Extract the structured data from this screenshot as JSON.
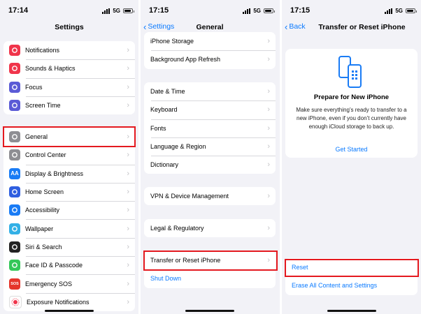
{
  "status_times": [
    "17:14",
    "17:15",
    "17:15"
  ],
  "network": "5G",
  "colors": {
    "accent": "#0a7aff",
    "highlight": "#e4191f"
  },
  "settings": {
    "title": "Settings",
    "group1": [
      {
        "label": "Notifications",
        "icon": "bell-icon",
        "color": "#f0354b"
      },
      {
        "label": "Sounds & Haptics",
        "icon": "speaker-icon",
        "color": "#f0354b"
      },
      {
        "label": "Focus",
        "icon": "moon-icon",
        "color": "#5b5bd6"
      },
      {
        "label": "Screen Time",
        "icon": "hourglass-icon",
        "color": "#5b5bd6"
      }
    ],
    "group2": [
      {
        "label": "General",
        "icon": "gear-icon",
        "color": "#8e8e93"
      },
      {
        "label": "Control Center",
        "icon": "switches-icon",
        "color": "#8e8e93"
      },
      {
        "label": "Display & Brightness",
        "icon": "text-size-icon",
        "color": "#1a7cf5",
        "glyph": "AA"
      },
      {
        "label": "Home Screen",
        "icon": "app-grid-icon",
        "color": "#2f5fe0"
      },
      {
        "label": "Accessibility",
        "icon": "accessibility-icon",
        "color": "#1a7cf5"
      },
      {
        "label": "Wallpaper",
        "icon": "flower-icon",
        "color": "#33b0e6"
      },
      {
        "label": "Siri & Search",
        "icon": "siri-icon",
        "color": "#222222"
      },
      {
        "label": "Face ID & Passcode",
        "icon": "face-id-icon",
        "color": "#34c759"
      },
      {
        "label": "Emergency SOS",
        "icon": "sos-icon",
        "color": "#e5352b",
        "glyph": "SOS"
      },
      {
        "label": "Exposure Notifications",
        "icon": "exposure-icon",
        "color": "#ffffff"
      }
    ]
  },
  "general": {
    "back": "Settings",
    "title": "General",
    "group1": [
      "iPhone Storage",
      "Background App Refresh"
    ],
    "group2": [
      "Date & Time",
      "Keyboard",
      "Fonts",
      "Language & Region",
      "Dictionary"
    ],
    "group3": [
      "VPN & Device Management"
    ],
    "group4": [
      "Legal & Regulatory"
    ],
    "group5": [
      "Transfer or Reset iPhone",
      "Shut Down"
    ]
  },
  "transfer": {
    "back": "Back",
    "title": "Transfer or Reset iPhone",
    "card_title": "Prepare for New iPhone",
    "card_body": "Make sure everything’s ready to transfer to a new iPhone, even if you don’t currently have enough iCloud storage to back up.",
    "card_link": "Get Started",
    "reset": "Reset",
    "erase": "Erase All Content and Settings"
  }
}
